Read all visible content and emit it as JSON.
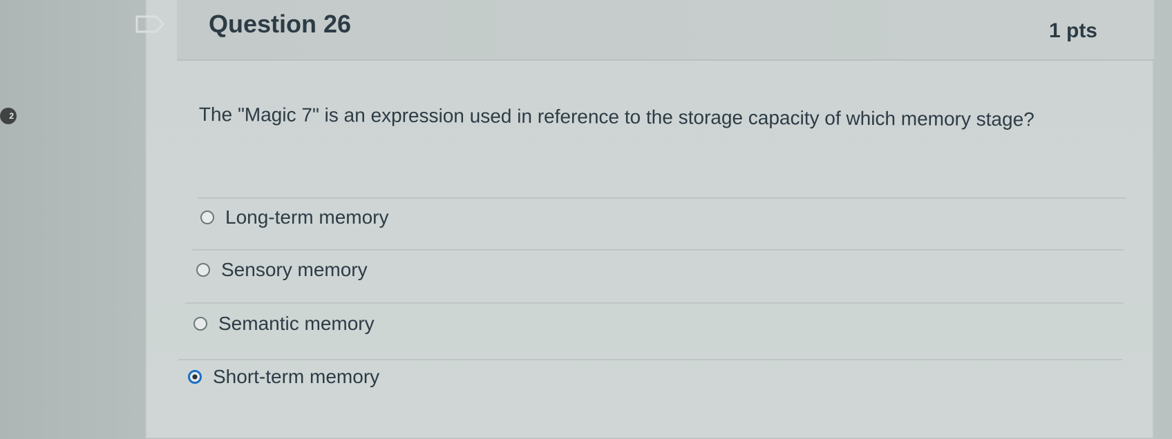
{
  "question": {
    "title": "Question 26",
    "points": "1 pts",
    "badge": "2",
    "text": "The \"Magic 7\" is an expression used in reference to the storage capacity of which memory stage?"
  },
  "answers": [
    {
      "label": "Long-term memory",
      "selected": false
    },
    {
      "label": "Sensory memory",
      "selected": false
    },
    {
      "label": "Semantic memory",
      "selected": false
    },
    {
      "label": "Short-term memory",
      "selected": true
    }
  ],
  "colors": {
    "text": "#2d3b45",
    "selected_radio": "#1b6fc3",
    "card_background": "#cfd6d5"
  }
}
